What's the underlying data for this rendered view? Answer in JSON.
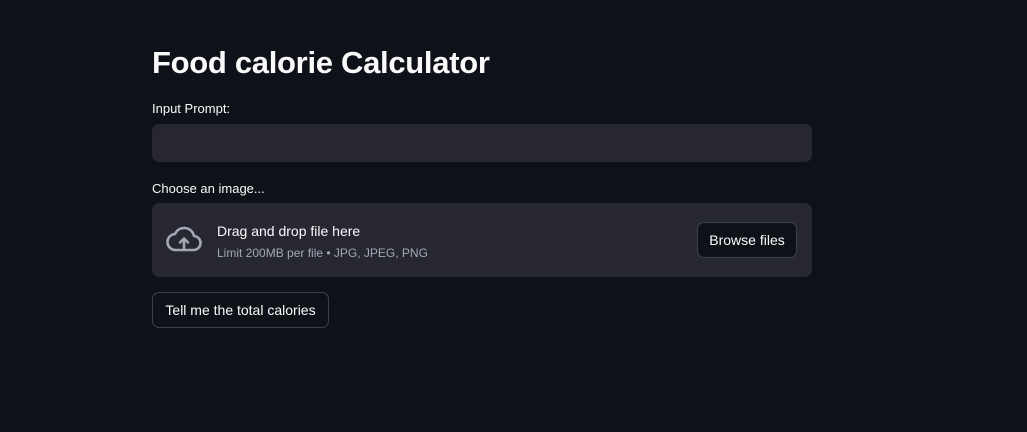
{
  "app": {
    "title": "Food calorie Calculator"
  },
  "prompt": {
    "label": "Input Prompt:",
    "value": "",
    "placeholder": ""
  },
  "uploader": {
    "label": "Choose an image...",
    "drop_title": "Drag and drop file here",
    "drop_subtitle": "Limit 200MB per file • JPG, JPEG, PNG",
    "browse_label": "Browse files",
    "icon": "cloud-upload-icon"
  },
  "actions": {
    "submit_label": "Tell me the total calories"
  },
  "colors": {
    "background": "#0e1117",
    "input_background": "#262730",
    "text": "#fafafa",
    "muted_text": "#a3a8b4",
    "button_border": "#3d404a"
  }
}
